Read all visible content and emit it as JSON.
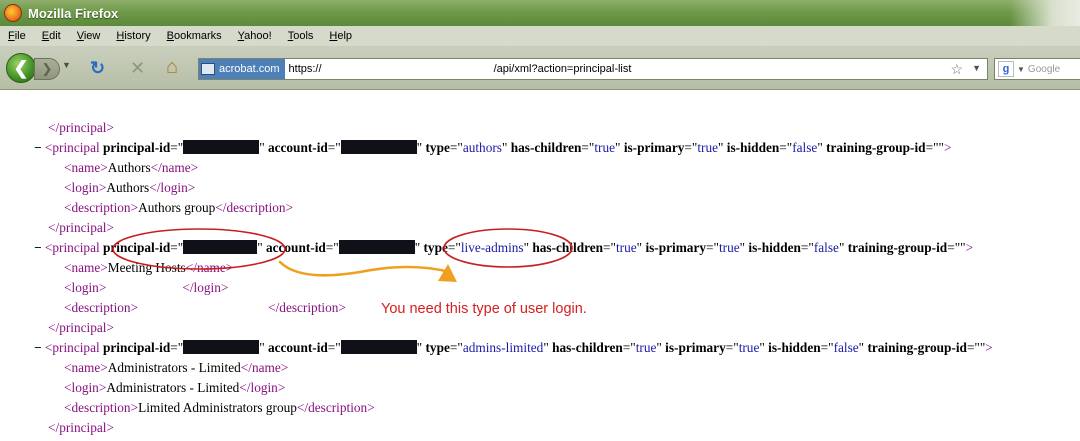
{
  "window": {
    "title": "Mozilla Firefox"
  },
  "menu": [
    {
      "key": "F",
      "rest": "ile"
    },
    {
      "key": "E",
      "rest": "dit"
    },
    {
      "key": "V",
      "rest": "iew"
    },
    {
      "key": "H",
      "rest": "istory"
    },
    {
      "key": "B",
      "rest": "ookmarks"
    },
    {
      "key": "Y",
      "rest": "ahoo!"
    },
    {
      "key": "T",
      "rest": "ools"
    },
    {
      "key": "H",
      "rest": "elp"
    }
  ],
  "nav": {
    "site_badge": "acrobat.com",
    "url_scheme": "https://",
    "url_path": "/api/xml?action=principal-list",
    "search_placeholder": "Google"
  },
  "xml": {
    "principal_tag": "principal",
    "name_tag": "name",
    "login_tag": "login",
    "description_tag": "description",
    "attr_principal_id": "principal-id",
    "attr_account_id": "account-id",
    "attr_type": "type",
    "attr_has_children": "has-children",
    "attr_is_primary": "is-primary",
    "attr_is_hidden": "is-hidden",
    "attr_training_group_id": "training-group-id",
    "val_true": "true",
    "val_false": "false",
    "val_empty": "",
    "records": [
      {
        "type": "authors",
        "name": "Authors",
        "login": "Authors",
        "description": "Authors group"
      },
      {
        "type": "live-admins",
        "name": "Meeting Hosts",
        "login": "",
        "description": ""
      },
      {
        "type": "admins-limited",
        "name": "Administrators - Limited",
        "login": "Administrators - Limited",
        "description": "Limited Administrators group"
      }
    ]
  },
  "annotation": {
    "note": "You need this type of user login."
  },
  "colors": {
    "annotation_red": "#d42020",
    "annotation_orange": "#f0a020",
    "tag_purple": "#881280",
    "value_blue": "#1a1aa6"
  }
}
